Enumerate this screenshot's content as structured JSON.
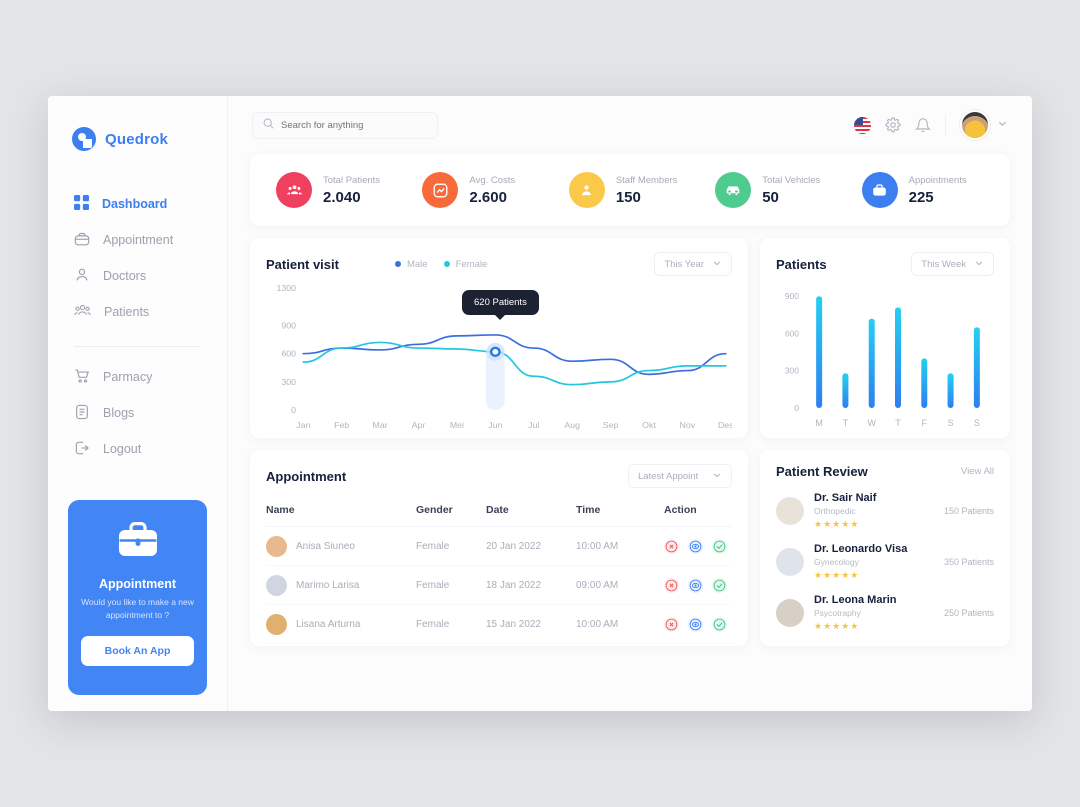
{
  "brand": {
    "name": "Quedrok",
    "logo_icon": "quedrok-logo-icon",
    "color": "#3d7ef0"
  },
  "sidebar": {
    "nav": [
      {
        "label": "Dashboard",
        "icon": "grid-icon",
        "active": true
      },
      {
        "label": "Appointment",
        "icon": "briefcase-icon",
        "active": false
      },
      {
        "label": "Doctors",
        "icon": "user-icon",
        "active": false
      },
      {
        "label": "Patients",
        "icon": "users-icon",
        "active": false
      }
    ],
    "nav_secondary": [
      {
        "label": "Parmacy",
        "icon": "cart-icon"
      },
      {
        "label": "Blogs",
        "icon": "document-icon"
      },
      {
        "label": "Logout",
        "icon": "logout-icon"
      }
    ],
    "promo": {
      "icon": "briefcase-icon",
      "title": "Appointment",
      "subtitle": "Would you like to make a new appointment to ?",
      "button": "Book An App",
      "bg": "#4285f4"
    }
  },
  "topbar": {
    "search_placeholder": "Search for anything",
    "search_value": "",
    "search_icon": "search-icon",
    "flag_icon": "us-flag-icon",
    "settings_icon": "gear-icon",
    "notification_icon": "bell-icon",
    "avatar_icon": "user-avatar",
    "chevron_icon": "chevron-down-icon"
  },
  "stats": [
    {
      "label": "Total Patients",
      "value": "2.040",
      "icon": "patients-group-icon",
      "color": "#ef4060"
    },
    {
      "label": "Avg. Costs",
      "value": "2.600",
      "icon": "chart-up-icon",
      "color": "#f96a3b"
    },
    {
      "label": "Staff Members",
      "value": "150",
      "icon": "staff-person-icon",
      "color": "#fbc94a"
    },
    {
      "label": "Total Vehicles",
      "value": "50",
      "icon": "ambulance-icon",
      "color": "#4ecb8e"
    },
    {
      "label": "Appointments",
      "value": "225",
      "icon": "briefcase-icon",
      "color": "#3d7ef0"
    }
  ],
  "patient_visit": {
    "title": "Patient visit",
    "legend": [
      {
        "label": "Male",
        "color": "#3b6fe0"
      },
      {
        "label": "Female",
        "color": "#25c7e0"
      }
    ],
    "filter": {
      "value": "This Year",
      "chevron": "chevron-down-icon"
    },
    "tooltip": "620 Patients"
  },
  "patients_panel": {
    "title": "Patients",
    "filter": {
      "value": "This Week",
      "chevron": "chevron-down-icon"
    }
  },
  "appointment": {
    "title": "Appointment",
    "filter": {
      "value": "Latest Appoint",
      "chevron": "chevron-down-icon"
    },
    "columns": [
      "Name",
      "Gender",
      "Date",
      "Time",
      "Action"
    ],
    "rows": [
      {
        "name": "Anisa Siuneo",
        "gender": "Female",
        "date": "20 Jan 2022",
        "time": "10:00 AM",
        "actions": [
          "cancel-icon",
          "view-icon",
          "approve-icon"
        ],
        "avatar": "#e8b98f"
      },
      {
        "name": "Marimo Larisa",
        "gender": "Female",
        "date": "18 Jan 2022",
        "time": "09:00 AM",
        "actions": [
          "cancel-icon",
          "view-icon",
          "approve-icon"
        ],
        "avatar": "#cfd6e0"
      },
      {
        "name": "Lisana Arturna",
        "gender": "Female",
        "date": "15 Jan 2022",
        "time": "10:00 AM",
        "actions": [
          "cancel-icon",
          "view-icon",
          "approve-icon"
        ],
        "avatar": "#e0b070"
      }
    ]
  },
  "patient_review": {
    "title": "Patient Review",
    "view_all": "View All",
    "doctors": [
      {
        "name": "Dr. Sair Naif",
        "specialty": "Orthopedic",
        "patients": "150 Patients",
        "stars": "★★★★★",
        "avatar": "#e9e2d8"
      },
      {
        "name": "Dr. Leonardo Visa",
        "specialty": "Gynecology",
        "patients": "350 Patients",
        "stars": "★★★★★",
        "avatar": "#dfe4ea"
      },
      {
        "name": "Dr. Leona Marin",
        "specialty": "Psycotraphy",
        "patients": "250 Patients",
        "stars": "★★★★★",
        "avatar": "#d8cfc6"
      }
    ]
  },
  "chart_data": [
    {
      "type": "line",
      "title": "Patient visit",
      "xlabel": "",
      "ylabel": "",
      "categories": [
        "Jan",
        "Feb",
        "Mar",
        "Apr",
        "Mei",
        "Jun",
        "Jul",
        "Aug",
        "Sep",
        "Okt",
        "Nov",
        "Des"
      ],
      "yticks": [
        0,
        300,
        600,
        900,
        1300
      ],
      "ylim": [
        0,
        1300
      ],
      "grid": false,
      "legend_position": "top-center",
      "highlight": {
        "category": "Jun",
        "value": 620,
        "label": "620 Patients"
      },
      "series": [
        {
          "name": "Male",
          "color": "#3b6fe0",
          "values": [
            600,
            660,
            640,
            700,
            790,
            800,
            660,
            520,
            540,
            380,
            420,
            600
          ]
        },
        {
          "name": "Female",
          "color": "#25c7e0",
          "values": [
            510,
            660,
            720,
            660,
            650,
            620,
            360,
            270,
            300,
            420,
            470,
            470
          ]
        }
      ]
    },
    {
      "type": "bar",
      "title": "Patients",
      "xlabel": "",
      "ylabel": "",
      "categories": [
        "M",
        "T",
        "W",
        "T",
        "F",
        "S",
        "S"
      ],
      "values": [
        900,
        280,
        720,
        810,
        400,
        280,
        650
      ],
      "yticks": [
        0,
        300,
        600,
        900
      ],
      "ylim": [
        0,
        950
      ],
      "grid": false,
      "bar_gradient": [
        "#25d0f0",
        "#2d7ff0"
      ]
    }
  ]
}
